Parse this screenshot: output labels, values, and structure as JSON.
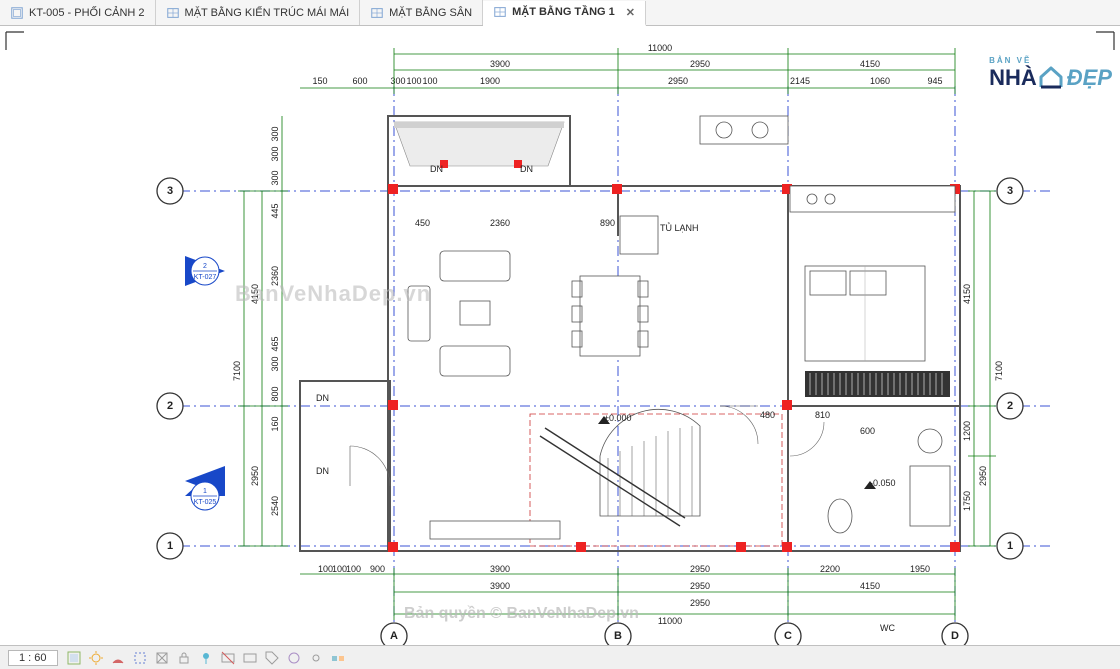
{
  "tabs": [
    {
      "label": "KT-005 - PHỐI CẢNH 2",
      "active": false
    },
    {
      "label": "MẶT BẰNG KIẾN TRÚC MÁI MÁI",
      "active": false
    },
    {
      "label": "MẶT BẰNG SÂN",
      "active": false
    },
    {
      "label": "MẶT BẰNG TẦNG 1",
      "active": true
    }
  ],
  "status": {
    "scale": "1 : 60"
  },
  "logo": {
    "top": "BẢN VẼ",
    "left": "NHÀ",
    "right": "ĐẸP"
  },
  "watermarks": {
    "center": "BanVeNhaDep.vn",
    "bottom": "Bản quyền © BanVeNhaDep.vn"
  },
  "dims": {
    "top_overall": "11000",
    "top_row1": [
      "3900",
      "2950",
      "4150"
    ],
    "top_row2_left": [
      "150",
      "600"
    ],
    "top_row2_mid": [
      "300",
      "100",
      "100"
    ],
    "top_row2_b": [
      "1900",
      "2950",
      "2145",
      "1060",
      "945"
    ],
    "left_overall": "7100",
    "left_row": [
      "4150",
      "2950"
    ],
    "left_row2": [
      "2540",
      "160",
      "800",
      "300",
      "465",
      "2360",
      "445",
      "300",
      "300",
      "300"
    ],
    "right_overall": "7100",
    "right_row": [
      "4150",
      "1200",
      "1750"
    ],
    "right_small": "2950",
    "bottom_overall": "11000",
    "bottom_row1": [
      "3900",
      "2950",
      "4150"
    ],
    "bottom_row2": [
      "100",
      "100",
      "100",
      "900",
      "3900",
      "2950",
      "2200",
      "1950"
    ],
    "bottom_row3": "2950",
    "inner_top": [
      "450",
      "2360",
      "890"
    ],
    "inner_mid": [
      "480",
      "810"
    ],
    "inner_wc": "600"
  },
  "room_labels": {
    "fridge": "TỦ LẠNH",
    "wc": "WC"
  },
  "levels": {
    "ground": "±0.000",
    "wc": "-0.050"
  },
  "dn_labels": [
    "DN",
    "DN",
    "DN",
    "DN"
  ],
  "grid_bubbles": {
    "nums": [
      "1",
      "2",
      "3"
    ],
    "letters": [
      "A",
      "B",
      "C",
      "D"
    ]
  },
  "section_marks": [
    {
      "num": "2",
      "sheet": "KT-027"
    },
    {
      "num": "1",
      "sheet": "KT-025"
    }
  ],
  "status_icons": [
    "toggle-icon",
    "sync-icon",
    "cut-icon",
    "pin-icon",
    "3d-icon",
    "arrow-icon",
    "marker-icon",
    "crop1-icon",
    "crop2-icon",
    "tag-icon",
    "sun-icon",
    "link-icon",
    "filter-icon",
    "grid-icon"
  ]
}
